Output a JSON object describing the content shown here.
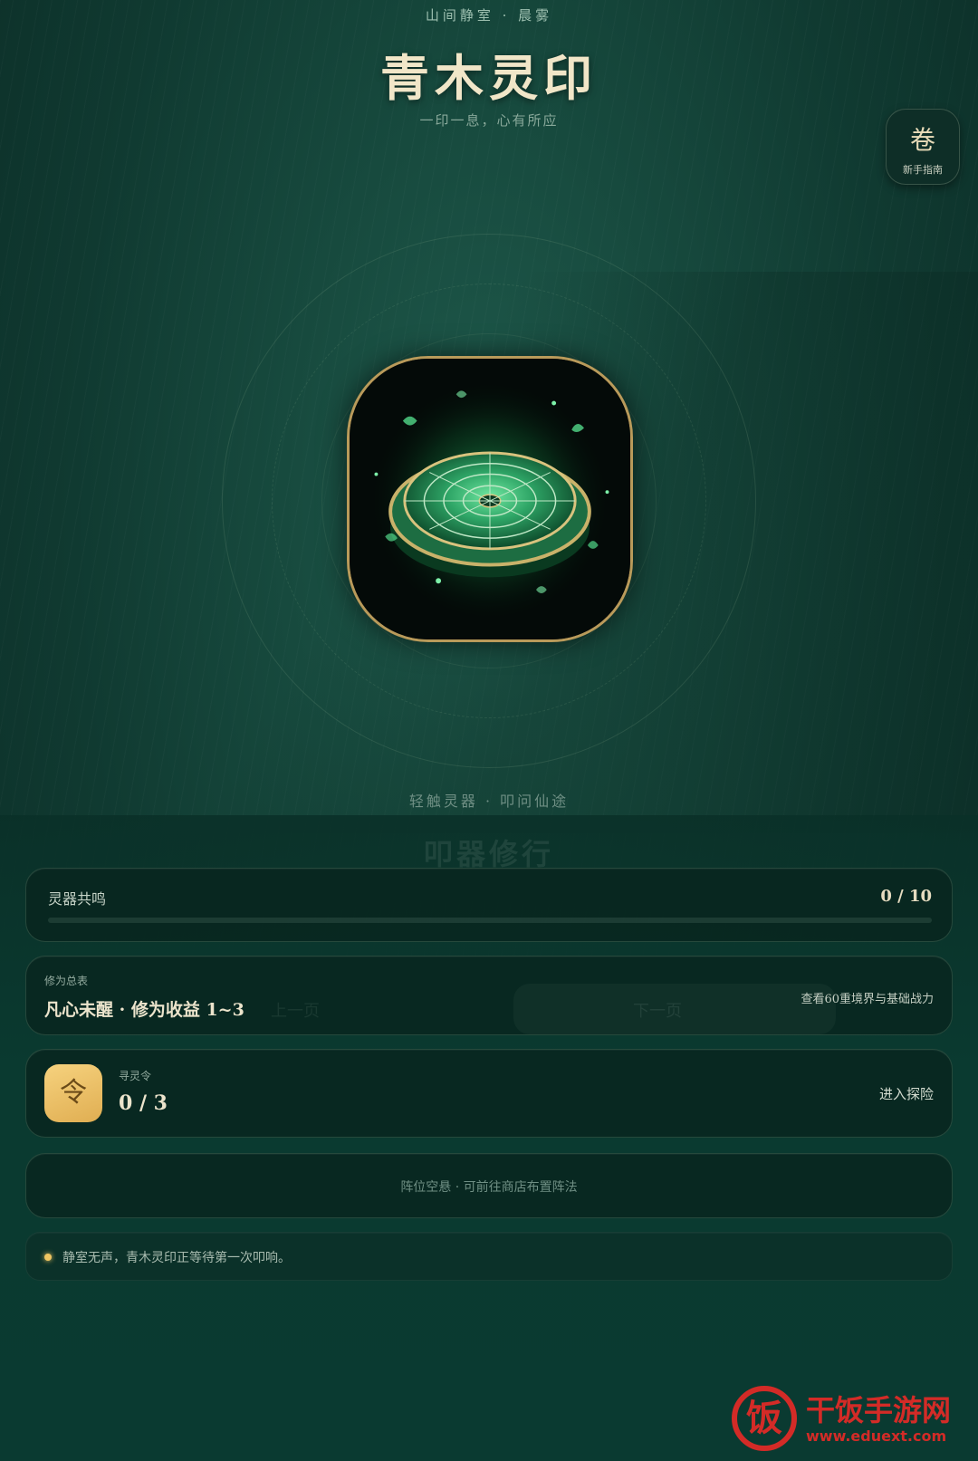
{
  "header": {
    "location": "山间静室 · 晨雾",
    "title": "青木灵印",
    "tagline": "一印一息，心有所应"
  },
  "guide_button": {
    "glyph": "卷",
    "label": "新手指南"
  },
  "seal": {
    "icon": "jade-seal-artifact",
    "hint": "轻触灵器 · 叩问仙途"
  },
  "section_heading": "叩器修行",
  "resonance": {
    "label": "灵器共鸣",
    "count": "0 / 10",
    "progress": 0
  },
  "cultivation": {
    "label": "修为总表",
    "value": "凡心未醒 · 修为收益 1~3",
    "link": "查看60重境界与基础战力",
    "ghost_prev": "上一页",
    "ghost_next": "下一页"
  },
  "token": {
    "icon_glyph": "令",
    "label": "寻灵令",
    "value": "0 / 3",
    "link": "进入探险"
  },
  "formation": {
    "text": "阵位空悬 · 可前往商店布置阵法"
  },
  "log": {
    "text": "静室无声，青木灵印正等待第一次叩响。"
  },
  "watermark": {
    "logo_glyph": "饭",
    "name": "干饭手游网",
    "url": "www.eduext.com"
  },
  "colors": {
    "accent_gold": "#f0c662",
    "frame_gold": "#b99a5a",
    "background": "#174a3e",
    "watermark_red": "#d32b27"
  }
}
